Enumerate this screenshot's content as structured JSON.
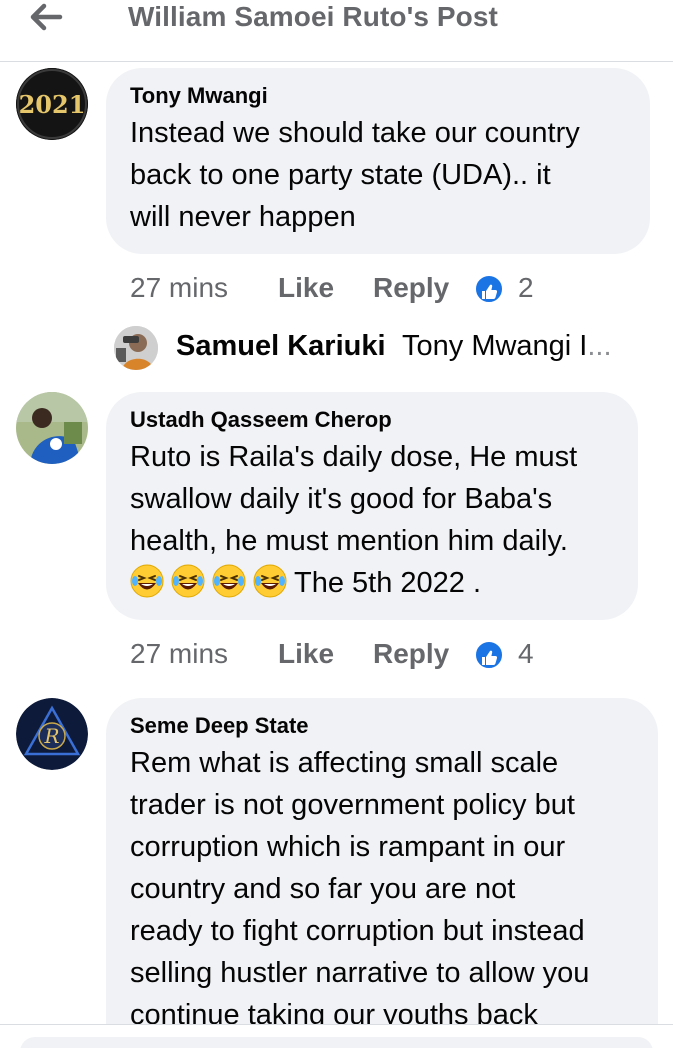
{
  "header": {
    "title": "William Samoei Ruto's Post",
    "back_icon": "arrow-left-icon"
  },
  "colors": {
    "bubble": "#f0f2f5",
    "secondary_text": "#65676b",
    "like_blue": "#1b74e4"
  },
  "comments": [
    {
      "author": "Tony Mwangi",
      "avatar_text": "2021",
      "lines": [
        "Instead we should take our country",
        "back to one party state (UDA).. it",
        "will never happen"
      ],
      "time": "27 mins",
      "like_label": "Like",
      "reply_label": "Reply",
      "like_count": "2"
    },
    {
      "author": "Ustadh Qasseem Cherop",
      "lines": [
        "Ruto is Raila's daily dose, He must",
        "swallow daily it's good for Baba's",
        "health, he must mention him daily."
      ],
      "last_line_text": "The 5th 2022 .",
      "emoji": "rolling-on-the-floor-laughing-emoji",
      "emoji_count": 4,
      "time": "27 mins",
      "like_label": "Like",
      "reply_label": "Reply",
      "like_count": "4"
    },
    {
      "author": "Seme Deep State",
      "avatar_text": "R",
      "lines": [
        "Rem what is affecting small scale",
        "trader is not government policy but",
        "corruption which is rampant in our",
        "country and so far you are not",
        "ready to fight corruption but instead",
        "selling hustler narrative to allow you",
        "continue taking our youths back"
      ]
    }
  ],
  "reply_preview": {
    "author": "Samuel Kariuki",
    "text": "Tony Mwangi I",
    "ellipsis": "..."
  }
}
